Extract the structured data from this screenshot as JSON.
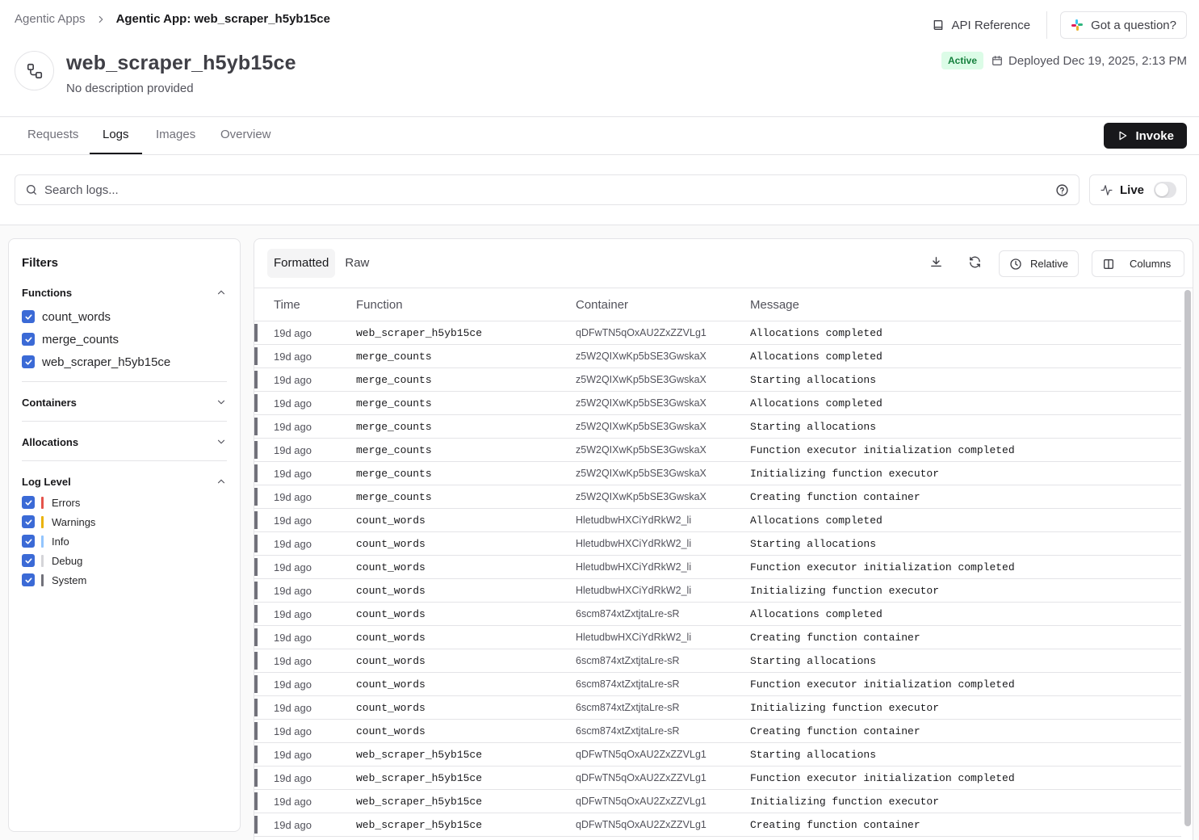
{
  "breadcrumb": {
    "parent": "Agentic Apps",
    "current": "Agentic App: web_scraper_h5yb15ce"
  },
  "header_actions": {
    "api_reference": "API Reference",
    "question": "Got a question?"
  },
  "app": {
    "name": "web_scraper_h5yb15ce",
    "description": "No description provided",
    "status": "Active",
    "deployed": "Deployed Dec 19, 2025, 2:13 PM"
  },
  "tabs": [
    "Requests",
    "Logs",
    "Images",
    "Overview"
  ],
  "active_tab": "Logs",
  "invoke_label": "Invoke",
  "search": {
    "placeholder": "Search logs...",
    "value": ""
  },
  "live": {
    "label": "Live",
    "enabled": false
  },
  "filters": {
    "title": "Filters",
    "functions": {
      "title": "Functions",
      "items": [
        "count_words",
        "merge_counts",
        "web_scraper_h5yb15ce"
      ]
    },
    "containers": {
      "title": "Containers"
    },
    "allocations": {
      "title": "Allocations"
    },
    "log_level": {
      "title": "Log Level",
      "items": [
        {
          "label": "Errors",
          "color": "#e5534b"
        },
        {
          "label": "Warnings",
          "color": "#eab308"
        },
        {
          "label": "Info",
          "color": "#93c5fd"
        },
        {
          "label": "Debug",
          "color": "#d4d4d8"
        },
        {
          "label": "System",
          "color": "#71717a"
        }
      ]
    }
  },
  "logs_view": {
    "modes": [
      "Formatted",
      "Raw"
    ],
    "active_mode": "Formatted",
    "relative_label": "Relative",
    "columns_label": "Columns"
  },
  "table": {
    "headers": [
      "Time",
      "Function",
      "Container",
      "Message"
    ],
    "rows": [
      [
        "19d ago",
        "web_scraper_h5yb15ce",
        "qDFwTN5qOxAU2ZxZZVLg1",
        "Allocations completed"
      ],
      [
        "19d ago",
        "merge_counts",
        "z5W2QIXwKp5bSE3GwskaX",
        "Allocations completed"
      ],
      [
        "19d ago",
        "merge_counts",
        "z5W2QIXwKp5bSE3GwskaX",
        "Starting allocations"
      ],
      [
        "19d ago",
        "merge_counts",
        "z5W2QIXwKp5bSE3GwskaX",
        "Allocations completed"
      ],
      [
        "19d ago",
        "merge_counts",
        "z5W2QIXwKp5bSE3GwskaX",
        "Starting allocations"
      ],
      [
        "19d ago",
        "merge_counts",
        "z5W2QIXwKp5bSE3GwskaX",
        "Function executor initialization completed"
      ],
      [
        "19d ago",
        "merge_counts",
        "z5W2QIXwKp5bSE3GwskaX",
        "Initializing function executor"
      ],
      [
        "19d ago",
        "merge_counts",
        "z5W2QIXwKp5bSE3GwskaX",
        "Creating function container"
      ],
      [
        "19d ago",
        "count_words",
        "HletudbwHXCiYdRkW2_li",
        "Allocations completed"
      ],
      [
        "19d ago",
        "count_words",
        "HletudbwHXCiYdRkW2_li",
        "Starting allocations"
      ],
      [
        "19d ago",
        "count_words",
        "HletudbwHXCiYdRkW2_li",
        "Function executor initialization completed"
      ],
      [
        "19d ago",
        "count_words",
        "HletudbwHXCiYdRkW2_li",
        "Initializing function executor"
      ],
      [
        "19d ago",
        "count_words",
        "6scm874xtZxtjtaLre-sR",
        "Allocations completed"
      ],
      [
        "19d ago",
        "count_words",
        "HletudbwHXCiYdRkW2_li",
        "Creating function container"
      ],
      [
        "19d ago",
        "count_words",
        "6scm874xtZxtjtaLre-sR",
        "Starting allocations"
      ],
      [
        "19d ago",
        "count_words",
        "6scm874xtZxtjtaLre-sR",
        "Function executor initialization completed"
      ],
      [
        "19d ago",
        "count_words",
        "6scm874xtZxtjtaLre-sR",
        "Initializing function executor"
      ],
      [
        "19d ago",
        "count_words",
        "6scm874xtZxtjtaLre-sR",
        "Creating function container"
      ],
      [
        "19d ago",
        "web_scraper_h5yb15ce",
        "qDFwTN5qOxAU2ZxZZVLg1",
        "Starting allocations"
      ],
      [
        "19d ago",
        "web_scraper_h5yb15ce",
        "qDFwTN5qOxAU2ZxZZVLg1",
        "Function executor initialization completed"
      ],
      [
        "19d ago",
        "web_scraper_h5yb15ce",
        "qDFwTN5qOxAU2ZxZZVLg1",
        "Initializing function executor"
      ],
      [
        "19d ago",
        "web_scraper_h5yb15ce",
        "qDFwTN5qOxAU2ZxZZVLg1",
        "Creating function container"
      ]
    ]
  },
  "icons": {
    "breadcrumb_separator": "chevron-right-icon",
    "api_reference": "book-icon",
    "question": "slack-icon",
    "app": "workflow-icon",
    "deployed": "calendar-icon",
    "invoke": "play-icon",
    "search": "search-icon",
    "help": "help-circle-icon",
    "live": "activity-icon",
    "download": "download-icon",
    "refresh": "refresh-icon",
    "relative": "clock-icon",
    "columns": "columns-icon"
  }
}
